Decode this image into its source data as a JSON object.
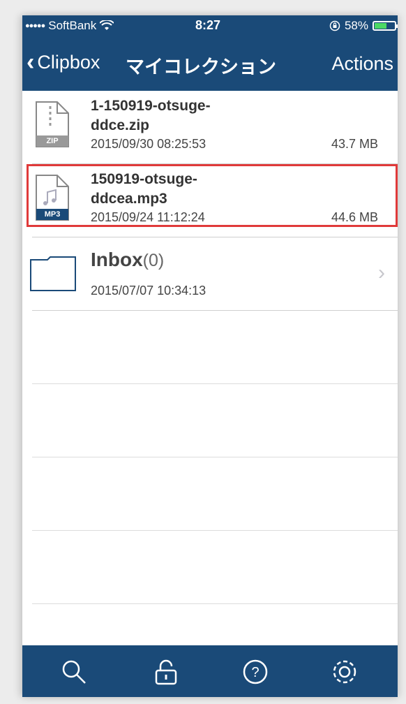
{
  "status": {
    "signal_dots": "●●●●●",
    "carrier": "SoftBank",
    "time": "8:27",
    "battery": "58%",
    "battery_level": 0.58
  },
  "nav": {
    "back_label": "Clipbox",
    "title": "マイコレクション",
    "actions_label": "Actions"
  },
  "files": [
    {
      "name_line1": "1-150919-otsuge-",
      "name_line2": "ddce.zip",
      "date": "2015/09/30 08:25:53",
      "size": "43.7 MB",
      "type_label": "ZIP",
      "icon": "zip-file-icon"
    },
    {
      "name_line1": "150919-otsuge-",
      "name_line2": "ddcea.mp3",
      "date": "2015/09/24 11:12:24",
      "size": "44.6 MB",
      "type_label": "MP3",
      "icon": "mp3-file-icon"
    }
  ],
  "folder": {
    "name": "Inbox",
    "count": "(0)",
    "date": "2015/07/07 10:34:13",
    "icon": "folder-icon"
  },
  "tabbar": {
    "icons": [
      "search-icon",
      "lock-icon",
      "help-icon",
      "gear-icon"
    ]
  },
  "colors": {
    "bar": "#1a4a78",
    "highlight": "#e03a3a"
  }
}
